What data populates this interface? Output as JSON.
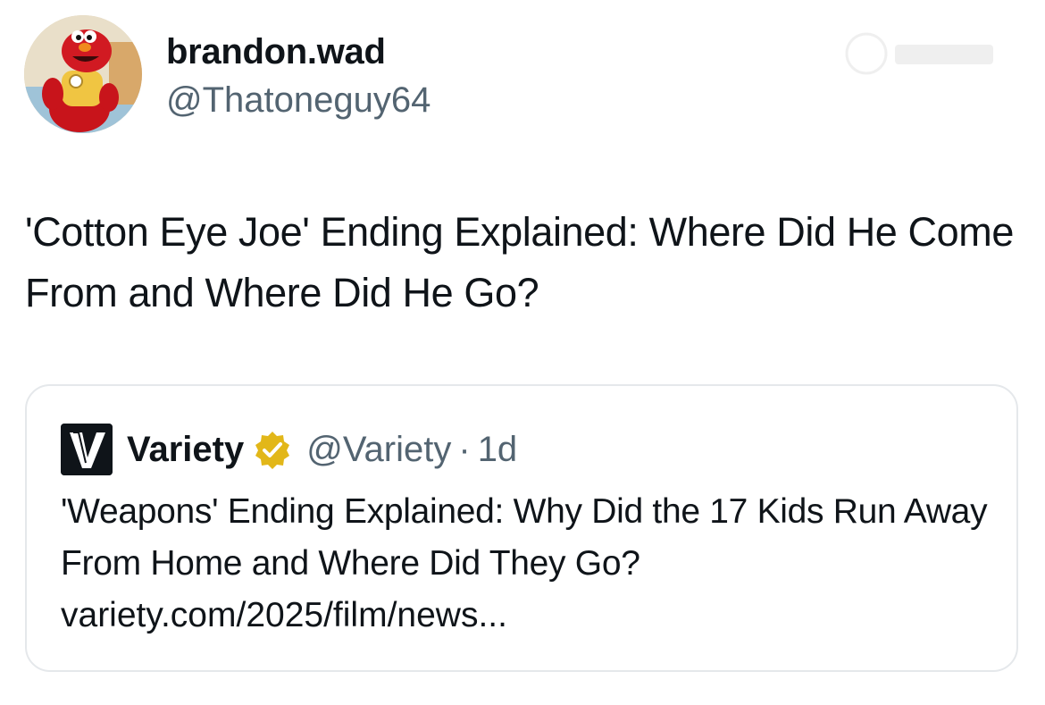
{
  "tweet": {
    "author": {
      "display_name": "brandon.wad",
      "handle": "@Thatoneguy64",
      "avatar_icon": "red-puppet-avatar"
    },
    "text": "'Cotton Eye Joe' Ending Explained: Where Did He Come From and Where Did He Go?"
  },
  "quote": {
    "logo_icon": "variety-logo-icon",
    "name": "Variety",
    "verified_icon": "gold-verified-badge-icon",
    "handle": "@Variety",
    "separator": "·",
    "time": "1d",
    "text": "'Weapons' Ending Explained: Why Did the 17 Kids Run Away From Home and Where Did They Go?",
    "link": "variety.com/2025/film/news..."
  },
  "colors": {
    "text_primary": "#0f1419",
    "text_secondary": "#536471",
    "card_border": "#e5e8eb",
    "verified_gold": "#e2b719",
    "background": "#ffffff"
  }
}
